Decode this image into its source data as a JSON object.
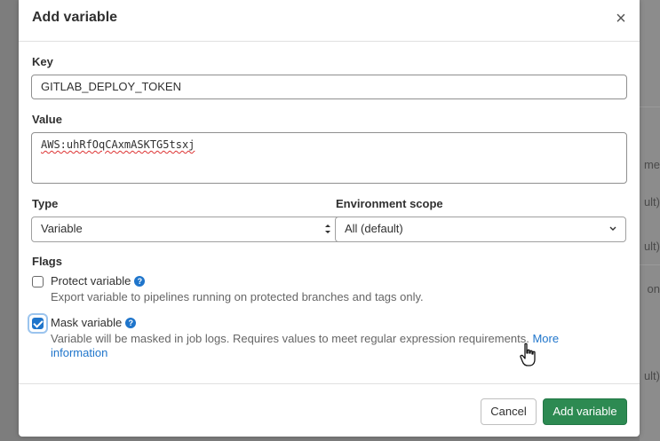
{
  "background": {
    "fragments": [
      "me",
      "ult)",
      "ult)",
      "on",
      "ult)"
    ]
  },
  "modal": {
    "title": "Add variable",
    "close_label": "×",
    "key": {
      "label": "Key",
      "value": "GITLAB_DEPLOY_TOKEN"
    },
    "value": {
      "label": "Value",
      "value": "AWS:uhRfOqCAxmASKTG5tsxj"
    },
    "type": {
      "label": "Type",
      "selected": "Variable"
    },
    "environment_scope": {
      "label": "Environment scope",
      "selected": "All (default)"
    },
    "flags": {
      "label": "Flags",
      "protect": {
        "label": "Protect variable",
        "checked": false,
        "help": "Export variable to pipelines running on protected branches and tags only."
      },
      "mask": {
        "label": "Mask variable",
        "checked": true,
        "help": "Variable will be masked in job logs. Requires values to meet regular expression requirements.",
        "link_line1": "More",
        "link_line2": "information"
      }
    },
    "buttons": {
      "cancel": "Cancel",
      "add": "Add variable"
    }
  },
  "colors": {
    "primary_blue": "#1f75cb",
    "confirm_green": "#2d8a52"
  },
  "icons": [
    "close-icon",
    "help-icon",
    "chevron-up-down-icon",
    "chevron-down-icon",
    "hand-pointer-icon"
  ]
}
